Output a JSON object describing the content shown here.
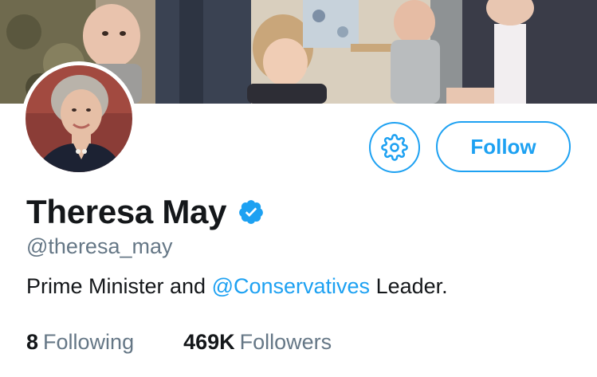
{
  "profile": {
    "display_name": "Theresa May",
    "handle": "@theresa_may",
    "bio": {
      "before": "Prime Minister and ",
      "mention": "@Conservatives",
      "after": " Leader."
    },
    "verified": true
  },
  "actions": {
    "follow_label": "Follow",
    "settings_icon": "gear-icon"
  },
  "stats": {
    "following_count": "8",
    "following_label": "Following",
    "followers_count": "469K",
    "followers_label": "Followers"
  },
  "colors": {
    "accent": "#1da1f2",
    "text_primary": "#14171a",
    "text_secondary": "#657786",
    "background": "#ffffff"
  }
}
